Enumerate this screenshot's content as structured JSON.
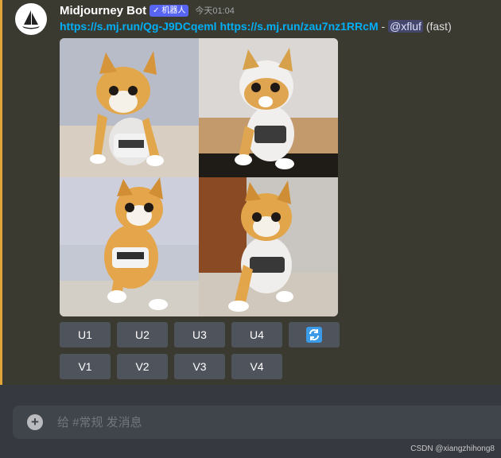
{
  "message": {
    "username": "Midjourney Bot",
    "bot_tag": "✓ 机器人",
    "timestamp": "今天01:04",
    "link1": "https://s.mj.run/Qg-J9DCqeml",
    "link2": "https://s.mj.run/zau7nz1RRcM",
    "separator": " - ",
    "mention": "@xfluf",
    "speed": " (fast)"
  },
  "buttons": {
    "upscale": [
      "U1",
      "U2",
      "U3",
      "U4"
    ],
    "variation": [
      "V1",
      "V2",
      "V3",
      "V4"
    ],
    "reroll_icon": "refresh-icon"
  },
  "composer": {
    "placeholder": "给 #常规 发消息"
  },
  "watermark": "CSDN @xiangzhihong8",
  "colors": {
    "background": "#36393f",
    "message_highlight": "#3b3a31",
    "mention_bar": "#e0a63a",
    "link": "#00aff4",
    "bot_tag": "#5865f2",
    "button": "#4f545c",
    "reroll_icon": "#3b9be8"
  }
}
